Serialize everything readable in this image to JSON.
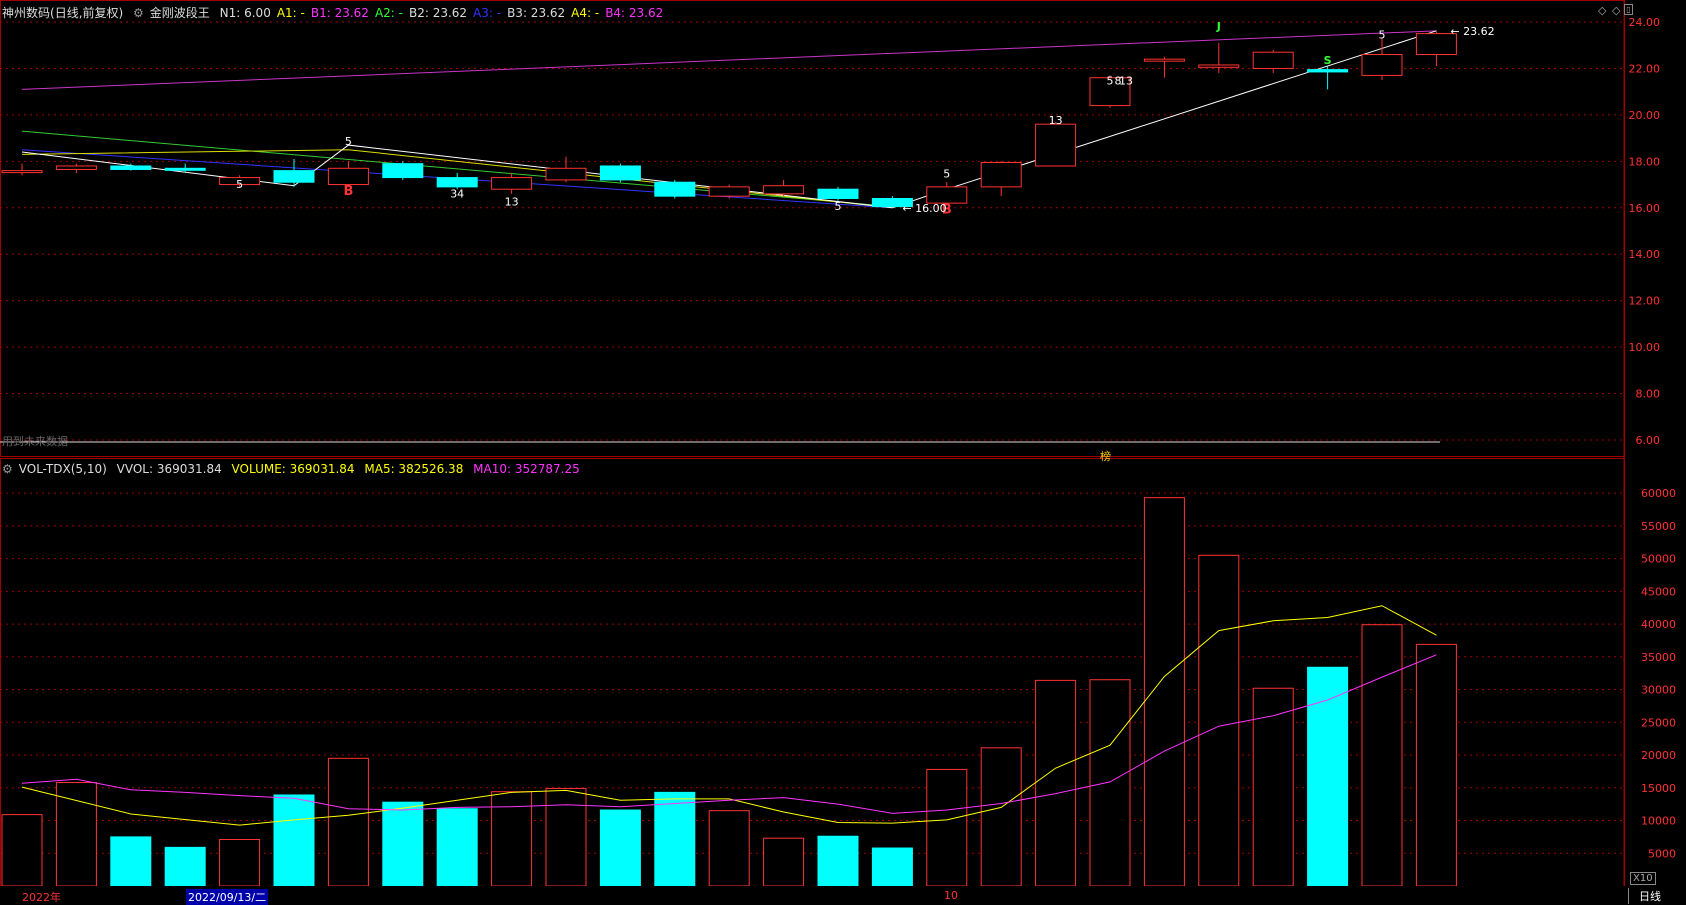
{
  "title": {
    "stock_name": "神州数码",
    "period_mode": "(日线,前复权)",
    "indicator_name": "金刚波段王",
    "params": [
      {
        "label": "N1:",
        "value": "6.00",
        "color": "#dddddd"
      },
      {
        "label": "A1:",
        "value": "-",
        "color": "#ffff00"
      },
      {
        "label": "B1:",
        "value": "23.62",
        "color": "#ff33ff"
      },
      {
        "label": "A2:",
        "value": "-",
        "color": "#33ff33"
      },
      {
        "label": "B2:",
        "value": "23.62",
        "color": "#dddddd"
      },
      {
        "label": "A3:",
        "value": "-",
        "color": "#3333ff"
      },
      {
        "label": "B3:",
        "value": "23.62",
        "color": "#dddddd"
      },
      {
        "label": "A4:",
        "value": "-",
        "color": "#ffff00"
      },
      {
        "label": "B4:",
        "value": "23.62",
        "color": "#ff33ff"
      }
    ]
  },
  "volume_header": {
    "name": "VOL-TDX(5,10)",
    "vvol": "VVOL: 369031.84",
    "volume": "VOLUME: 369031.84",
    "ma5": "MA5: 382526.38",
    "ma10": "MA10: 352787.25"
  },
  "price_axis": {
    "min": 6,
    "max": 24,
    "ticks": [
      "24.00",
      "22.00",
      "20.00",
      "18.00",
      "16.00",
      "14.00",
      "12.00",
      "10.00",
      "8.00",
      "6.00"
    ]
  },
  "volume_axis": {
    "ticks": [
      "60000",
      "55000",
      "50000",
      "45000",
      "40000",
      "35000",
      "30000",
      "25000",
      "20000",
      "15000",
      "10000",
      "5000"
    ],
    "unit_label": "X10"
  },
  "overlay_text": {
    "future_data_label": "用到未来数据",
    "rank_label": "榜",
    "low_marker": "16.00",
    "high_marker": "23.62"
  },
  "date_labels": {
    "year": "2022年",
    "selected_date": "2022/09/13/二",
    "month": "10"
  },
  "period_tab": "日线",
  "colors": {
    "up": "#ff3333",
    "down": "#00ffff",
    "ma5": "#ffff00",
    "ma10": "#ff33ff",
    "grid": "#a00000"
  },
  "chart_data": {
    "type": "candlestick",
    "candles": [
      {
        "o": 17.6,
        "c": 17.6,
        "h": 17.9,
        "l": 17.4,
        "v": 10900
      },
      {
        "o": 17.65,
        "c": 17.8,
        "h": 17.9,
        "l": 17.5,
        "v": 15800
      },
      {
        "o": 17.8,
        "c": 17.65,
        "h": 17.9,
        "l": 17.6,
        "v": 7500
      },
      {
        "o": 17.7,
        "c": 17.65,
        "h": 17.9,
        "l": 17.5,
        "v": 5900
      },
      {
        "o": 17.0,
        "c": 17.3,
        "h": 17.4,
        "l": 16.9,
        "v": 7100
      },
      {
        "o": 17.6,
        "c": 17.1,
        "h": 18.1,
        "l": 16.9,
        "v": 13900
      },
      {
        "o": 17.0,
        "c": 17.7,
        "h": 18.0,
        "l": 16.9,
        "v": 19500
      },
      {
        "o": 17.9,
        "c": 17.3,
        "h": 18.0,
        "l": 17.2,
        "v": 12800
      },
      {
        "o": 17.3,
        "c": 16.9,
        "h": 17.5,
        "l": 16.8,
        "v": 11800
      },
      {
        "o": 16.8,
        "c": 17.3,
        "h": 17.5,
        "l": 16.6,
        "v": 14400
      },
      {
        "o": 17.2,
        "c": 17.7,
        "h": 18.2,
        "l": 17.1,
        "v": 14900
      },
      {
        "o": 17.8,
        "c": 17.2,
        "h": 17.9,
        "l": 17.1,
        "v": 11600
      },
      {
        "o": 17.1,
        "c": 16.5,
        "h": 17.2,
        "l": 16.4,
        "v": 14300
      },
      {
        "o": 16.5,
        "c": 16.9,
        "h": 17.0,
        "l": 16.4,
        "v": 11500
      },
      {
        "o": 16.6,
        "c": 16.95,
        "h": 17.2,
        "l": 16.5,
        "v": 7300
      },
      {
        "o": 16.8,
        "c": 16.4,
        "h": 16.9,
        "l": 16.3,
        "v": 7600
      },
      {
        "o": 16.4,
        "c": 16.05,
        "h": 16.5,
        "l": 16.0,
        "v": 5800
      },
      {
        "o": 16.2,
        "c": 16.9,
        "h": 17.1,
        "l": 16.1,
        "v": 17800
      },
      {
        "o": 16.9,
        "c": 17.95,
        "h": 18.0,
        "l": 16.5,
        "v": 21100
      },
      {
        "o": 17.8,
        "c": 19.6,
        "h": 19.7,
        "l": 17.8,
        "v": 31400
      },
      {
        "o": 20.4,
        "c": 21.6,
        "h": 21.7,
        "l": 20.3,
        "v": 31500
      },
      {
        "o": 22.4,
        "c": 22.4,
        "h": 22.5,
        "l": 21.6,
        "v": 59300
      },
      {
        "o": 22.05,
        "c": 22.15,
        "h": 23.1,
        "l": 21.8,
        "v": 50500
      },
      {
        "o": 22.0,
        "c": 22.7,
        "h": 22.8,
        "l": 21.8,
        "v": 30200
      },
      {
        "o": 21.95,
        "c": 21.85,
        "h": 22.1,
        "l": 21.1,
        "v": 33400
      },
      {
        "o": 21.7,
        "c": 22.6,
        "h": 23.3,
        "l": 21.5,
        "v": 39900
      },
      {
        "o": 22.6,
        "c": 23.5,
        "h": 23.6,
        "l": 22.1,
        "v": 36900
      }
    ],
    "ma5_line": [
      15100,
      null,
      11000,
      null,
      9300,
      10100,
      10800,
      11900,
      null,
      14300,
      14600,
      13100,
      13300,
      13300,
      11300,
      9700,
      9600,
      10100,
      12000,
      18000,
      21500,
      32000,
      39000,
      40500,
      41000,
      42800,
      38300
    ],
    "ma10_line": [
      15700,
      16300,
      14700,
      14300,
      13800,
      13400,
      11800,
      11600,
      12000,
      12100,
      12400,
      12100,
      12600,
      13100,
      13500,
      12500,
      11100,
      11600,
      12600,
      14100,
      15900,
      20600,
      24400,
      26000,
      28400,
      31900,
      35300
    ],
    "annotations": [
      {
        "text": "5",
        "i": 4,
        "y": 16.85,
        "color": "#ffffff"
      },
      {
        "text": "5",
        "i": 6,
        "y": 18.7,
        "color": "#ffffff"
      },
      {
        "text": "B",
        "i": 6,
        "y": 16.55,
        "color": "#ff3333"
      },
      {
        "text": "34",
        "i": 8,
        "y": 16.45,
        "color": "#ffffff"
      },
      {
        "text": "13",
        "i": 9,
        "y": 16.1,
        "color": "#ffffff"
      },
      {
        "text": "5",
        "i": 15,
        "y": 15.9,
        "color": "#ffffff"
      },
      {
        "text": "5",
        "i": 17,
        "y": 17.3,
        "color": "#ffffff"
      },
      {
        "text": "B",
        "i": 17,
        "y": 15.75,
        "color": "#ff3333"
      },
      {
        "text": "13",
        "i": 19,
        "y": 19.6,
        "color": "#ffffff"
      },
      {
        "text": "5",
        "i": 20,
        "y": 21.3,
        "color": "#ffffff"
      },
      {
        "text": "8",
        "i": 20,
        "y": 21.3,
        "color": "#ffffff"
      },
      {
        "text": "13",
        "i": 20,
        "y": 21.3,
        "color": "#ffffff"
      },
      {
        "text": "J",
        "i": 22,
        "y": 23.65,
        "color": "#33ff33"
      },
      {
        "text": "S",
        "i": 24,
        "y": 22.2,
        "color": "#33ff33"
      },
      {
        "text": "5",
        "i": 25,
        "y": 23.3,
        "color": "#ffffff"
      }
    ],
    "wave_line": [
      [
        0,
        18.4
      ],
      [
        5,
        16.95
      ],
      [
        6,
        18.7
      ],
      [
        16,
        16.0
      ],
      [
        17,
        16.8
      ],
      [
        26,
        23.62
      ]
    ],
    "yellow_line": [
      [
        0,
        18.3
      ],
      [
        6,
        18.5
      ],
      [
        16,
        16.0
      ]
    ],
    "green_line": [
      [
        0,
        19.3
      ],
      [
        16,
        16.05
      ]
    ],
    "blue_line": [
      [
        0,
        18.5
      ],
      [
        16,
        16.0
      ]
    ],
    "top_channel": [
      [
        0,
        21.1
      ],
      [
        26,
        23.62
      ]
    ],
    "price_ylim": [
      6,
      24
    ],
    "volume_ylim": [
      0,
      62000
    ]
  }
}
